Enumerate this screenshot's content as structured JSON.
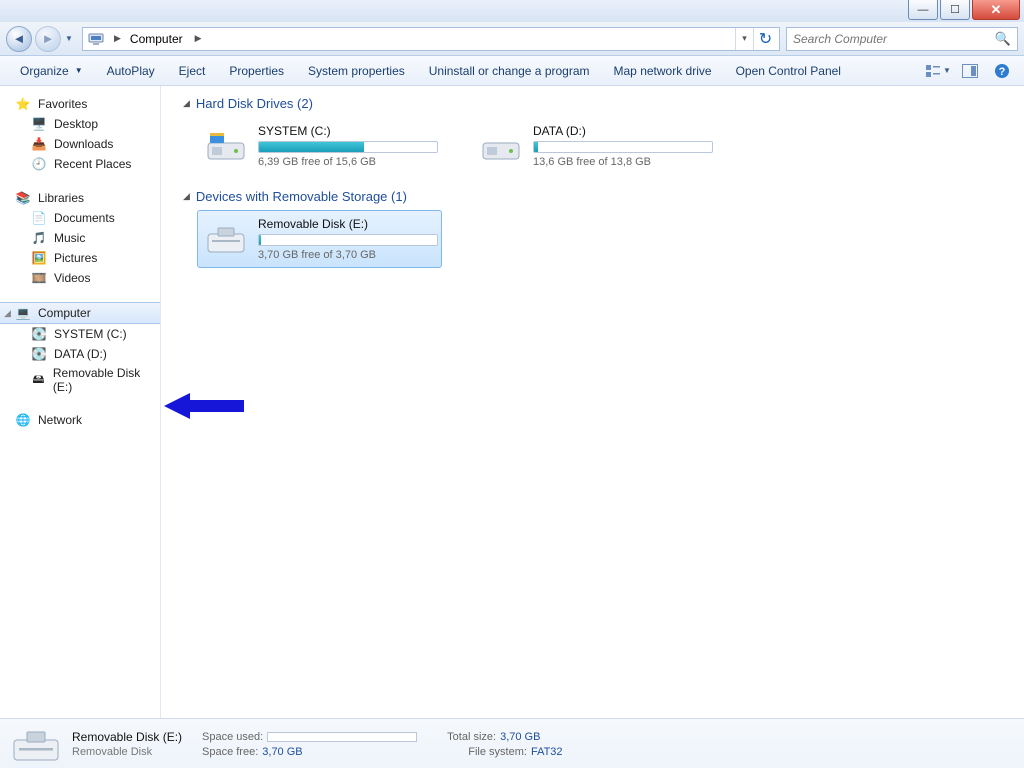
{
  "window": {
    "title": "Computer"
  },
  "nav": {
    "address_segments": [
      "Computer"
    ],
    "search_placeholder": "Search Computer"
  },
  "toolbar": {
    "organize": "Organize",
    "items": [
      "AutoPlay",
      "Eject",
      "Properties",
      "System properties",
      "Uninstall or change a program",
      "Map network drive",
      "Open Control Panel"
    ]
  },
  "sidebar": {
    "favorites": {
      "label": "Favorites",
      "items": [
        "Desktop",
        "Downloads",
        "Recent Places"
      ]
    },
    "libraries": {
      "label": "Libraries",
      "items": [
        "Documents",
        "Music",
        "Pictures",
        "Videos"
      ]
    },
    "computer": {
      "label": "Computer",
      "items": [
        "SYSTEM (C:)",
        "DATA (D:)",
        "Removable Disk (E:)"
      ]
    },
    "network": {
      "label": "Network"
    }
  },
  "sections": {
    "hdd": {
      "title": "Hard Disk Drives (2)"
    },
    "removable": {
      "title": "Devices with Removable Storage (1)"
    }
  },
  "drives": {
    "c": {
      "name": "SYSTEM (C:)",
      "free": "6,39 GB free of 15,6 GB",
      "fill_pct": 59
    },
    "d": {
      "name": "DATA (D:)",
      "free": "13,6 GB free of 13,8 GB",
      "fill_pct": 2
    },
    "e": {
      "name": "Removable Disk (E:)",
      "free": "3,70 GB free of 3,70 GB",
      "fill_pct": 1
    }
  },
  "details": {
    "title": "Removable Disk (E:)",
    "subtitle": "Removable Disk",
    "space_used_label": "Space used:",
    "space_free_label": "Space free:",
    "space_free_val": "3,70 GB",
    "total_size_label": "Total size:",
    "total_size_val": "3,70 GB",
    "filesystem_label": "File system:",
    "filesystem_val": "FAT32"
  }
}
